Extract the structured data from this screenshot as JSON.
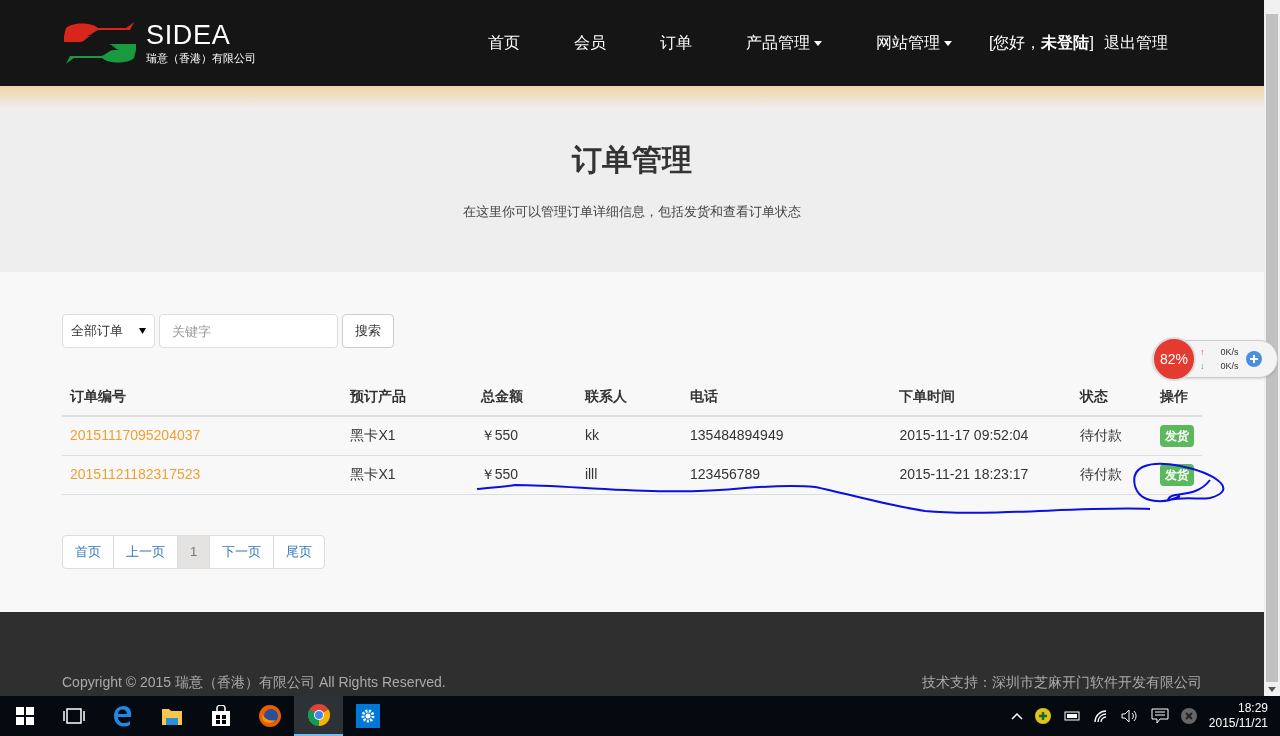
{
  "brand": {
    "name": "SIDEA",
    "subtitle": "瑞意（香港）有限公司"
  },
  "nav": [
    {
      "label": "首页",
      "dropdown": false
    },
    {
      "label": "会员",
      "dropdown": false
    },
    {
      "label": "订单",
      "dropdown": false
    },
    {
      "label": "产品管理",
      "dropdown": true
    },
    {
      "label": "网站管理",
      "dropdown": true
    }
  ],
  "user_greeting": "[您好，**未登陆**]",
  "logout": "退出管理",
  "hero": {
    "title": "订单管理",
    "subtitle": "在这里你可以管理订单详细信息，包括发货和查看订单状态"
  },
  "filter": {
    "select": "全部订单",
    "search_placeholder": "关键字",
    "search_button": "搜索"
  },
  "table": {
    "columns": [
      "订单编号",
      "预订产品",
      "总金额",
      "联系人",
      "电话",
      "下单时间",
      "状态",
      "操作"
    ],
    "rows": [
      {
        "order_no": "20151117095204037",
        "product": "黑卡X1",
        "amount": "￥550",
        "contact": "kk",
        "phone": "135484894949",
        "time": "2015-11-17 09:52:04",
        "status": "待付款",
        "action": "发货"
      },
      {
        "order_no": "20151121182317523",
        "product": "黑卡X1",
        "amount": "￥550",
        "contact": "illl",
        "phone": "123456789",
        "time": "2015-11-21 18:23:17",
        "status": "待付款",
        "action": "发货"
      }
    ]
  },
  "pagination": [
    {
      "label": "首页",
      "selected": false
    },
    {
      "label": "上一页",
      "selected": false
    },
    {
      "label": "1",
      "selected": true
    },
    {
      "label": "下一页",
      "selected": false
    },
    {
      "label": "尾页",
      "selected": false
    }
  ],
  "footer": {
    "copyright": "Copyright © 2015 瑞意（香港）有限公司 All Rights Reserved.",
    "support": "技术支持：深圳市芝麻开门软件开发有限公司"
  },
  "speed_widget": {
    "percent": "82%",
    "up_arrow": "↑",
    "up": "0K/s",
    "down_arrow": "↓",
    "down": "0K/s"
  },
  "taskbar": {
    "time": "18:29",
    "date": "2015/11/21",
    "apps": [
      {
        "kind": "start",
        "active": false
      },
      {
        "kind": "taskview",
        "active": false
      },
      {
        "kind": "edge",
        "active": false
      },
      {
        "kind": "explorer",
        "active": false
      },
      {
        "kind": "store",
        "active": false
      },
      {
        "kind": "firefox",
        "active": false
      },
      {
        "kind": "chrome",
        "active": true
      },
      {
        "kind": "settings",
        "active": false
      }
    ]
  }
}
